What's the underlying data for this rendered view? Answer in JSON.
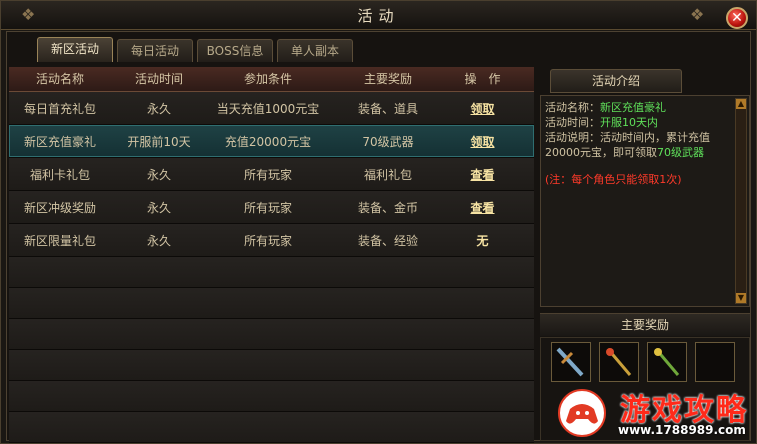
{
  "window": {
    "title": "活动",
    "close_icon": "close-icon"
  },
  "tabs": [
    {
      "label": "新区活动",
      "active": true
    },
    {
      "label": "每日活动",
      "active": false
    },
    {
      "label": "BOSS信息",
      "active": false
    },
    {
      "label": "单人副本",
      "active": false
    }
  ],
  "table": {
    "headers": [
      "活动名称",
      "活动时间",
      "参加条件",
      "主要奖励",
      "操　作"
    ],
    "rows": [
      {
        "name": "每日首充礼包",
        "time": "永久",
        "cond": "当天充值1000元宝",
        "reward": "装备、道具",
        "action": "领取"
      },
      {
        "name": "新区充值豪礼",
        "time": "开服前10天",
        "cond": "充值20000元宝",
        "reward": "70级武器",
        "action": "领取"
      },
      {
        "name": "福利卡礼包",
        "time": "永久",
        "cond": "所有玩家",
        "reward": "福利礼包",
        "action": "查看"
      },
      {
        "name": "新区冲级奖励",
        "time": "永久",
        "cond": "所有玩家",
        "reward": "装备、金币",
        "action": "查看"
      },
      {
        "name": "新区限量礼包",
        "time": "永久",
        "cond": "所有玩家",
        "reward": "装备、经验",
        "action": "无"
      }
    ],
    "selected_row": 1
  },
  "intro": {
    "header": "活动介绍",
    "name_label": "活动名称：",
    "name_value": "新区充值豪礼",
    "time_label": "活动时间：",
    "time_value": "开服10天内",
    "desc_label": "活动说明：",
    "desc_text": "活动时间内，累计充值20000元宝，即可领取",
    "desc_highlight": "70级武器",
    "note": "(注：每个角色只能领取1次)"
  },
  "rewards": {
    "header": "主要奖励"
  },
  "watermark": {
    "title": "游戏攻略",
    "url": "www.1788989.com"
  },
  "colors": {
    "highlight_green": "#5fe05a",
    "note_red": "#ff3a2a",
    "link_gold": "#f7e3a3",
    "selected_teal": "#1f4245"
  }
}
